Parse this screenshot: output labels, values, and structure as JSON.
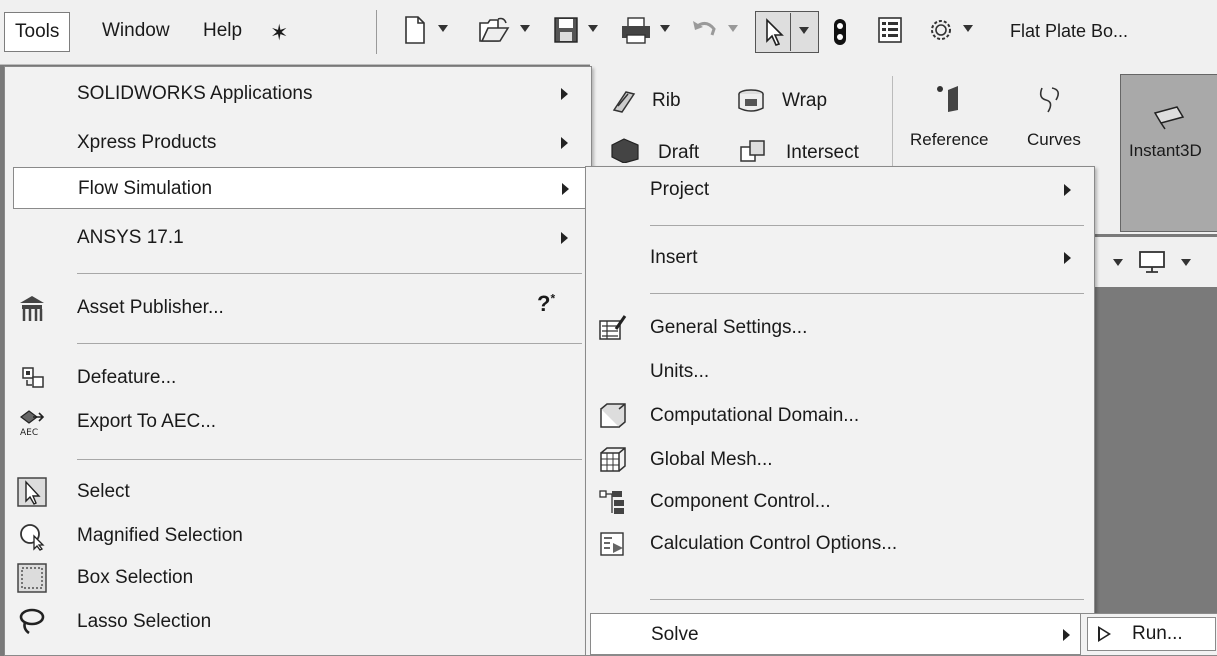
{
  "menubar": {
    "tools": "Tools",
    "window": "Window",
    "help": "Help"
  },
  "toolbar": {
    "document_title": "Flat Plate Bo..."
  },
  "ribbon": {
    "rib": "Rib",
    "wrap": "Wrap",
    "draft": "Draft",
    "intersect": "Intersect",
    "reference": "Reference",
    "curves": "Curves",
    "instant3d": "Instant3D"
  },
  "tools_menu": {
    "solidworks_applications": "SOLIDWORKS Applications",
    "xpress_products": "Xpress Products",
    "flow_simulation": "Flow Simulation",
    "ansys": "ANSYS 17.1",
    "asset_publisher": "Asset Publisher...",
    "defeature": "Defeature...",
    "export_to_aec": "Export To AEC...",
    "select": "Select",
    "magnified_selection": "Magnified Selection",
    "box_selection": "Box Selection",
    "lasso_selection": "Lasso Selection"
  },
  "flow_menu": {
    "project": "Project",
    "insert": "Insert",
    "general_settings": "General Settings...",
    "units": "Units...",
    "computational_domain": "Computational Domain...",
    "global_mesh": "Global Mesh...",
    "component_control": "Component Control...",
    "calculation_control_options": "Calculation Control Options...",
    "solve": "Solve"
  },
  "solve_menu": {
    "run": "Run..."
  }
}
